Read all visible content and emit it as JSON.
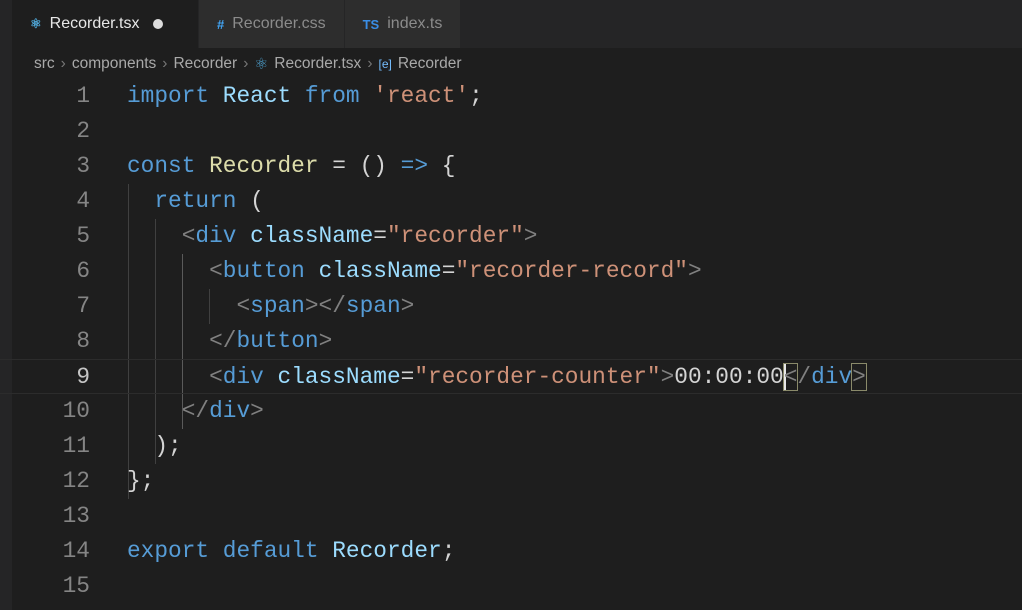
{
  "tabs": [
    {
      "label": "Recorder.tsx",
      "icon": "react-icon",
      "icon_glyph": "⚛",
      "icon_color": "#4fa6d6",
      "active": true,
      "modified": true
    },
    {
      "label": "Recorder.css",
      "icon": "css-hash-icon",
      "icon_glyph": "#",
      "icon_color": "#42a5f5",
      "active": false
    },
    {
      "label": "index.ts",
      "icon": "typescript-icon",
      "icon_glyph": "TS",
      "icon_color": "#3a8ee6",
      "active": false
    }
  ],
  "breadcrumb": [
    "src",
    "components",
    "Recorder",
    "Recorder.tsx",
    "Recorder"
  ],
  "code": [
    {
      "n": "1",
      "t": [
        [
          "import",
          "kw"
        ],
        [
          " ",
          "pl"
        ],
        [
          "React",
          "id"
        ],
        [
          " ",
          "pl"
        ],
        [
          "from",
          "kw"
        ],
        [
          " ",
          "pl"
        ],
        [
          "'react'",
          "str"
        ],
        [
          ";",
          "pl"
        ]
      ]
    },
    {
      "n": "2",
      "t": []
    },
    {
      "n": "3",
      "t": [
        [
          "const",
          "kw"
        ],
        [
          " ",
          "pl"
        ],
        [
          "Recorder",
          "fn"
        ],
        [
          " = () ",
          "pl"
        ],
        [
          "=>",
          "kw"
        ],
        [
          " {",
          "pl"
        ]
      ]
    },
    {
      "n": "4",
      "t": [
        [
          "  ",
          "pl"
        ],
        [
          "return",
          "kw"
        ],
        [
          " (",
          "pl"
        ]
      ]
    },
    {
      "n": "5",
      "t": [
        [
          "    ",
          "pl"
        ],
        [
          "<",
          "br"
        ],
        [
          "div",
          "tag"
        ],
        [
          " ",
          "pl"
        ],
        [
          "className",
          "attr"
        ],
        [
          "=",
          "pl"
        ],
        [
          "\"recorder\"",
          "str"
        ],
        [
          ">",
          "br"
        ]
      ]
    },
    {
      "n": "6",
      "t": [
        [
          "      ",
          "pl"
        ],
        [
          "<",
          "br"
        ],
        [
          "button",
          "tag"
        ],
        [
          " ",
          "pl"
        ],
        [
          "className",
          "attr"
        ],
        [
          "=",
          "pl"
        ],
        [
          "\"recorder-record\"",
          "str"
        ],
        [
          ">",
          "br"
        ]
      ]
    },
    {
      "n": "7",
      "t": [
        [
          "        ",
          "pl"
        ],
        [
          "<",
          "br"
        ],
        [
          "span",
          "tag"
        ],
        [
          "></",
          "br"
        ],
        [
          "span",
          "tag"
        ],
        [
          ">",
          "br"
        ]
      ]
    },
    {
      "n": "8",
      "t": [
        [
          "      ",
          "pl"
        ],
        [
          "</",
          "br"
        ],
        [
          "button",
          "tag"
        ],
        [
          ">",
          "br"
        ]
      ]
    },
    {
      "n": "9",
      "t": [
        [
          "      ",
          "pl"
        ],
        [
          "<",
          "br"
        ],
        [
          "div",
          "tag"
        ],
        [
          " ",
          "pl"
        ],
        [
          "className",
          "attr"
        ],
        [
          "=",
          "pl"
        ],
        [
          "\"recorder-counter\"",
          "str"
        ],
        [
          ">",
          "br"
        ],
        [
          "00:00:00",
          "pl"
        ],
        [
          "|",
          "caret"
        ],
        [
          "<",
          "match"
        ],
        [
          "/",
          "br"
        ],
        [
          "div",
          "tag"
        ],
        [
          ">",
          "match"
        ]
      ]
    },
    {
      "n": "10",
      "t": [
        [
          "    ",
          "pl"
        ],
        [
          "</",
          "br"
        ],
        [
          "div",
          "tag"
        ],
        [
          ">",
          "br"
        ]
      ]
    },
    {
      "n": "11",
      "t": [
        [
          "  );",
          "pl"
        ]
      ]
    },
    {
      "n": "12",
      "t": [
        [
          "};",
          "pl"
        ]
      ]
    },
    {
      "n": "13",
      "t": []
    },
    {
      "n": "14",
      "t": [
        [
          "export",
          "kw"
        ],
        [
          " ",
          "pl"
        ],
        [
          "default",
          "kw"
        ],
        [
          " ",
          "pl"
        ],
        [
          "Recorder",
          "id"
        ],
        [
          ";",
          "pl"
        ]
      ]
    },
    {
      "n": "15",
      "t": []
    }
  ]
}
